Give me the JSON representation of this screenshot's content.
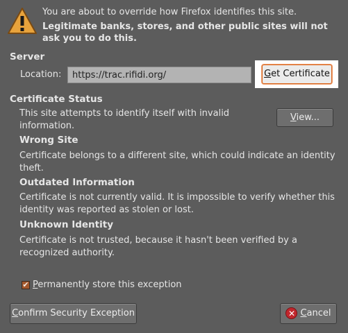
{
  "header": {
    "warning_line": "You are about to override how Firefox identifies this site.",
    "legit_line1": "Legitimate banks, stores, and other public sites will not",
    "legit_line2": "ask you to do this."
  },
  "server": {
    "title": "Server",
    "location_label": "Location:",
    "location_value": "https://trac.rifidi.org/",
    "get_certificate_button": "Get Certificate",
    "get_certificate_rest": "et Certificate",
    "get_certificate_accel": "G"
  },
  "status": {
    "title": "Certificate Status",
    "line1": "This site attempts to identify itself with invalid",
    "line2": "information.",
    "view_button": "View...",
    "view_accel": "V",
    "view_rest": "iew..."
  },
  "wrong_site": {
    "title": "Wrong Site",
    "line1": "Certificate belongs to a different site, which could indicate an identity",
    "line2": "theft."
  },
  "outdated": {
    "title": "Outdated Information",
    "line1": "Certificate is not currently valid. It is impossible to verify whether this",
    "line2": "identity was reported as stolen or lost."
  },
  "unknown": {
    "title": "Unknown Identity",
    "line1": "Certificate is not trusted, because it hasn't been verified by a",
    "line2": "recognized authority."
  },
  "exception": {
    "checkbox_label": "Permanently store this exception",
    "checkbox_accel": "P",
    "checkbox_rest": "ermanently store this exception",
    "checked": true
  },
  "footer": {
    "confirm_button": "Confirm Security Exception",
    "confirm_accel": "C",
    "confirm_rest": "onfirm Security Exception",
    "cancel_button": "Cancel",
    "cancel_accel": "C",
    "cancel_rest": "ancel"
  },
  "colors": {
    "background": "#5c5c5c",
    "text": "#e6e6e6",
    "focus_ring": "#d8641c",
    "warning_icon": "#e8a33c",
    "cancel_icon": "#c1272d"
  },
  "icons": {
    "warning": "warning-triangle-icon",
    "cancel": "cancel-icon",
    "check": "checkmark-icon"
  }
}
